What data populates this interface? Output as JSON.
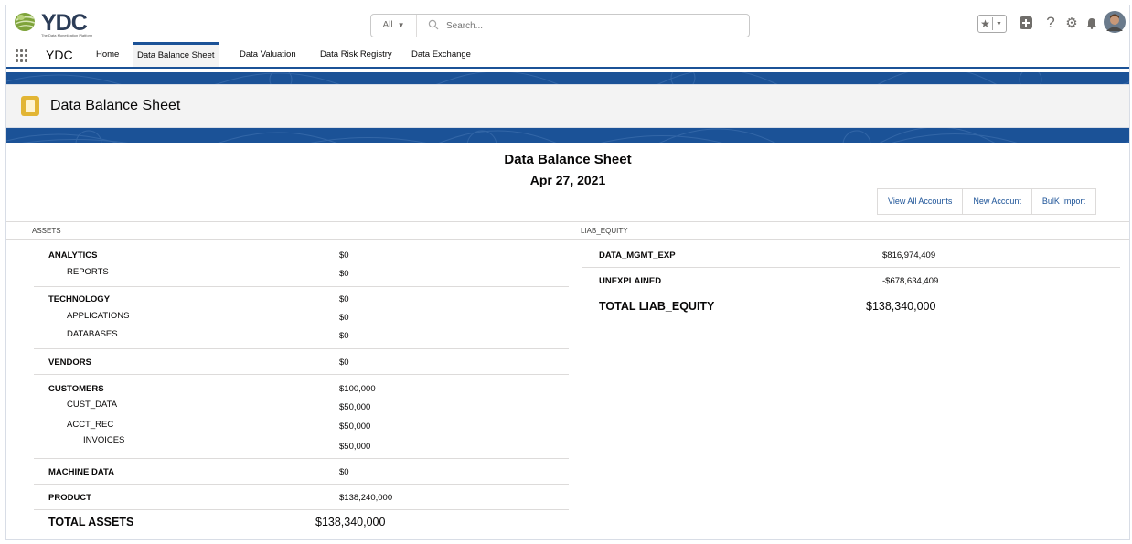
{
  "header": {
    "logo_text": "YDC",
    "logo_tagline": "The Data Monetization Platform",
    "search_scope": "All",
    "search_placeholder": "Search..."
  },
  "nav": {
    "app_name": "YDC",
    "items": [
      {
        "label": "Home"
      },
      {
        "label": "Data Balance Sheet"
      },
      {
        "label": "Data Valuation"
      },
      {
        "label": "Data Risk Registry"
      },
      {
        "label": "Data Exchange"
      }
    ]
  },
  "page": {
    "title": "Data Balance Sheet"
  },
  "report": {
    "title": "Data Balance Sheet",
    "date": "Apr 27, 2021",
    "buttons": [
      "View All Accounts",
      "New Account",
      "BulK Import"
    ]
  },
  "assets": {
    "header": "ASSETS",
    "groups": [
      {
        "rows": [
          {
            "label": "ANALYTICS",
            "value": "$0"
          },
          {
            "label": "REPORTS",
            "value": "$0"
          }
        ]
      },
      {
        "rows": [
          {
            "label": "TECHNOLOGY",
            "value": "$0"
          },
          {
            "label": "APPLICATIONS",
            "value": "$0"
          },
          {
            "label": "DATABASES",
            "value": "$0"
          }
        ]
      },
      {
        "rows": [
          {
            "label": "VENDORS",
            "value": "$0"
          }
        ]
      },
      {
        "rows": [
          {
            "label": "CUSTOMERS",
            "value": "$100,000"
          },
          {
            "label": "CUST_DATA",
            "value": "$50,000"
          },
          {
            "label": "ACCT_REC",
            "value": "$50,000"
          },
          {
            "label": "INVOICES",
            "value": "$50,000"
          }
        ]
      },
      {
        "rows": [
          {
            "label": "MACHINE DATA",
            "value": "$0"
          }
        ]
      },
      {
        "rows": [
          {
            "label": "PRODUCT",
            "value": "$138,240,000"
          }
        ]
      }
    ],
    "total_label": "TOTAL ASSETS",
    "total_value": "$138,340,000"
  },
  "liab_equity": {
    "header": "LIAB_EQUITY",
    "rows": [
      {
        "label": "DATA_MGMT_EXP",
        "value": "$816,974,409"
      },
      {
        "label": "UNEXPLAINED",
        "value": "-$678,634,409"
      }
    ],
    "total_label": "TOTAL LIAB_EQUITY",
    "total_value": "$138,340,000"
  },
  "colors": {
    "brand_blue": "#1b5297",
    "page_icon": "#e2b534",
    "link": "#1b5297"
  },
  "icons": [
    "globe-logo-icon",
    "search-icon",
    "favorites-star-icon",
    "add-icon",
    "help-icon",
    "setup-gear-icon",
    "notification-bell-icon",
    "user-avatar",
    "app-launcher-icon",
    "balance-sheet-page-icon"
  ]
}
